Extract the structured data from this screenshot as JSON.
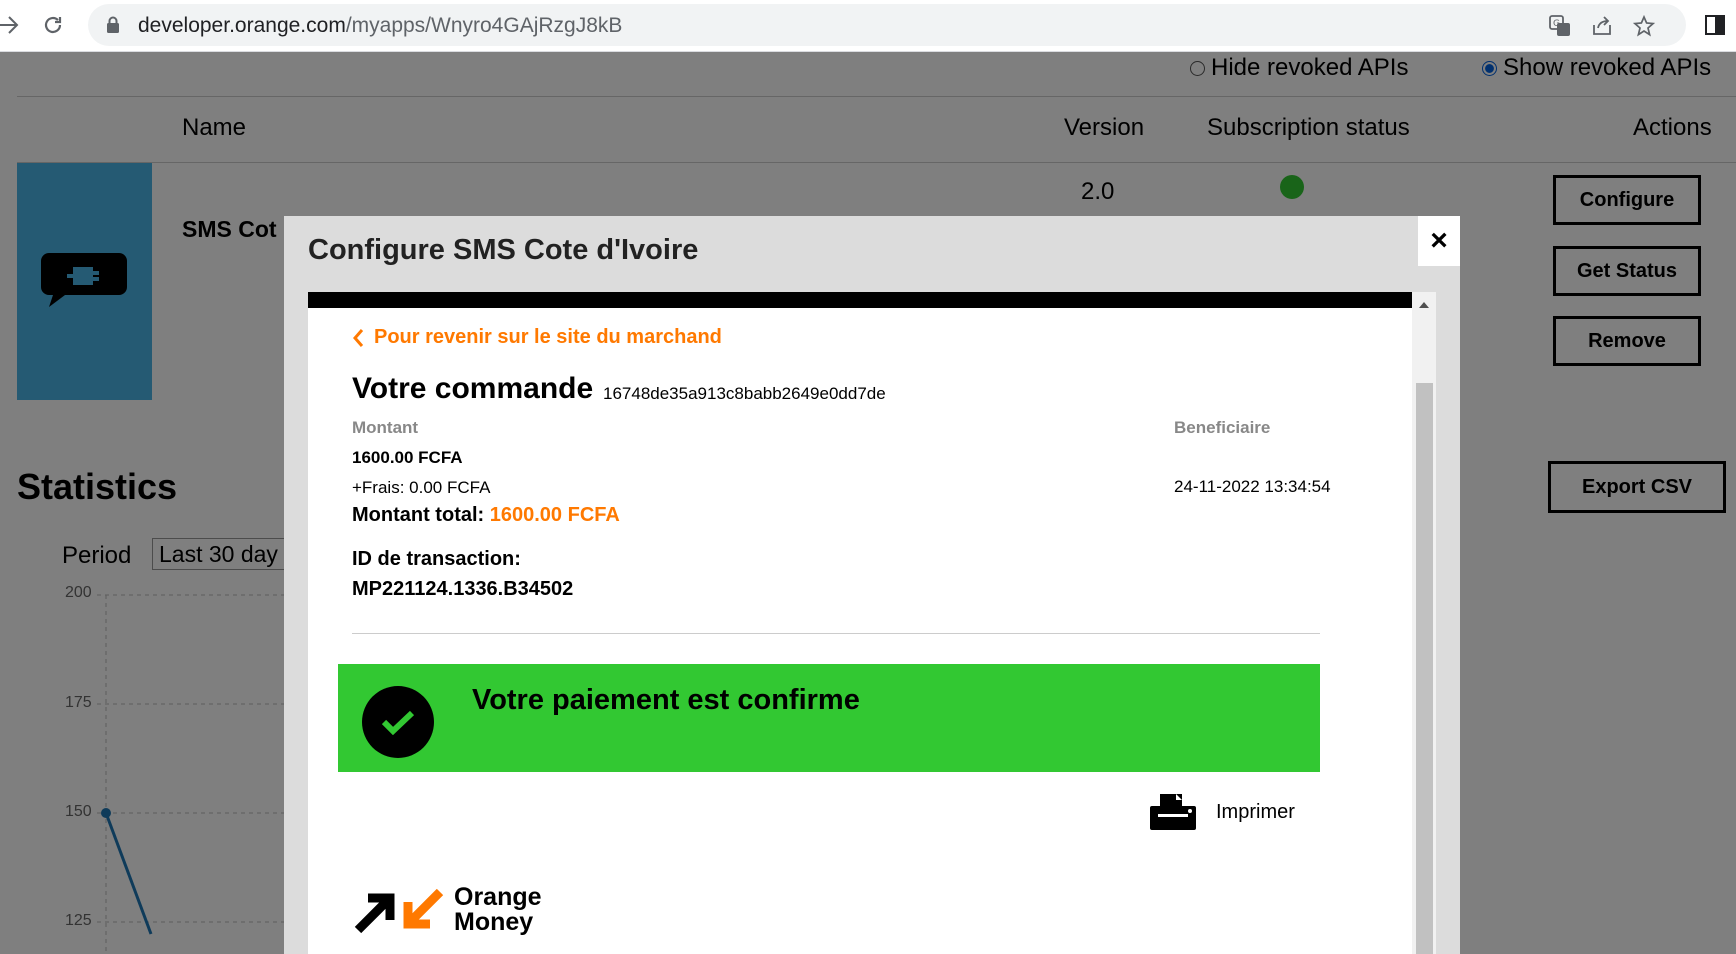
{
  "browser": {
    "url_host": "developer.orange.com",
    "url_path": "/myapps/Wnyro4GAjRzgJ8kB"
  },
  "page": {
    "filters": {
      "hide_revoked": "Hide revoked APIs",
      "show_revoked": "Show revoked APIs",
      "selected": "show_revoked"
    },
    "table": {
      "headers": {
        "name": "Name",
        "version": "Version",
        "status": "Subscription status",
        "actions": "Actions"
      },
      "row": {
        "name": "SMS Cot",
        "version": "2.0",
        "status_color": "#32c832"
      }
    },
    "actions": {
      "configure": "Configure",
      "get_status": "Get Status",
      "remove": "Remove"
    },
    "statistics": {
      "title": "Statistics",
      "export": "Export CSV",
      "period_label": "Period",
      "period_value": "Last 30 day",
      "y_ticks": [
        "200",
        "175",
        "150",
        "125"
      ]
    }
  },
  "chart_data": {
    "type": "line",
    "title": "",
    "xlabel": "",
    "ylabel": "",
    "ylim": [
      125,
      200
    ],
    "y_ticks": [
      200,
      175,
      150,
      125
    ],
    "series": [
      {
        "values": [
          150,
          125
        ]
      }
    ]
  },
  "modal": {
    "title": "Configure SMS Cote d'Ivoire",
    "close": "×",
    "back_link": "Pour revenir sur le site du marchand",
    "order_title": "Votre commande",
    "order_id": "16748de35a913c8babb2649e0dd7de",
    "amount_label": "Montant",
    "amount": "1600.00 FCFA",
    "fees": "+Frais: 0.00 FCFA",
    "total_label": "Montant total:",
    "total_value": "1600.00 FCFA",
    "beneficiary_label": "Beneficiaire",
    "date": "24-11-2022 13:34:54",
    "txn_label": "ID de transaction:",
    "txn_id": "MP221124.1336.B34502",
    "success": "Votre paiement est confirme",
    "print": "Imprimer",
    "logo_line1": "Orange",
    "logo_line2": "Money",
    "colors": {
      "accent": "#ff7900",
      "success": "#32c832"
    }
  }
}
